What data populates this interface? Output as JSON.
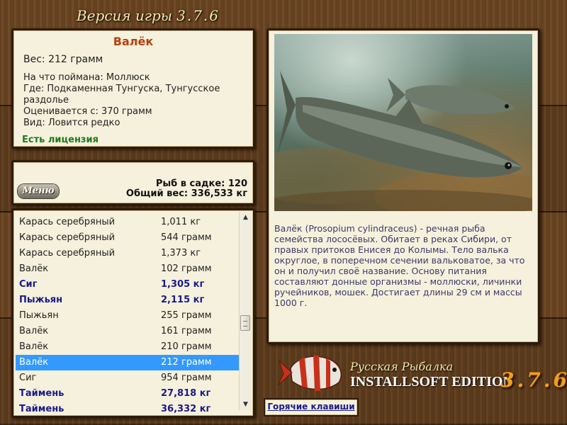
{
  "header": {
    "title": "Версия игры",
    "version": "3.7.6"
  },
  "fish_info": {
    "name": "Валёк",
    "weight": "Вес: 212 грамм",
    "bait": "На что поймана: Моллюск",
    "location": "Где: Подкаменная Тунгуска, Тунгусское раздолье",
    "value": "Оценивается с: 370 грамм",
    "kind": "Вид: Ловится редко",
    "license": "Есть лицензия"
  },
  "menu": {
    "button_label": "Меню",
    "fish_count": "Рыб в садке: 120",
    "total_weight": "Общий вес: 336,533 кг"
  },
  "catch_list": [
    {
      "name": "Карась серебряный",
      "weight": "1,011 кг",
      "bold": false,
      "selected": false
    },
    {
      "name": "Карась серебряный",
      "weight": "544 грамм",
      "bold": false,
      "selected": false
    },
    {
      "name": "Карась серебряный",
      "weight": "1,373 кг",
      "bold": false,
      "selected": false
    },
    {
      "name": "Валёк",
      "weight": "102 грамм",
      "bold": false,
      "selected": false
    },
    {
      "name": "Сиг",
      "weight": "1,305 кг",
      "bold": true,
      "selected": false
    },
    {
      "name": "Пыжьян",
      "weight": "2,115 кг",
      "bold": true,
      "selected": false
    },
    {
      "name": "Пыжьян",
      "weight": "255 грамм",
      "bold": false,
      "selected": false
    },
    {
      "name": "Валёк",
      "weight": "161 грамм",
      "bold": false,
      "selected": false
    },
    {
      "name": "Валёк",
      "weight": "210 грамм",
      "bold": false,
      "selected": false
    },
    {
      "name": "Валёк",
      "weight": "212 грамм",
      "bold": false,
      "selected": true
    },
    {
      "name": "Сиг",
      "weight": "954 грамм",
      "bold": false,
      "selected": false
    },
    {
      "name": "Таймень",
      "weight": "27,818 кг",
      "bold": true,
      "selected": false
    },
    {
      "name": "Таймень",
      "weight": "36,332 кг",
      "bold": true,
      "selected": false
    }
  ],
  "description": "Валёк (Prosopium cylindraceus) - речная рыба семейства лососёвых. Обитает в реках Сибири, от правых притоков Енисея до Колымы. Тело валька округлое, в поперечном сечении вальковатое, за что он и получил своё название. Основу питания составляют донные организмы - моллюски, личинки ручейников, мошек. Достигает длины 29 см и массы 1000 г.",
  "hotkeys_label": "Горячие клавиши",
  "branding": {
    "line1": "Русская Рыбалка",
    "line2": "INSTALLSOFT EDITION",
    "version": "3.7.6"
  },
  "colors": {
    "accent_title": "#b5400c",
    "license_green": "#1f7a1f",
    "list_bold": "#1a1a8c",
    "selection": "#3399ff",
    "version_orange": "#f2a01a"
  }
}
